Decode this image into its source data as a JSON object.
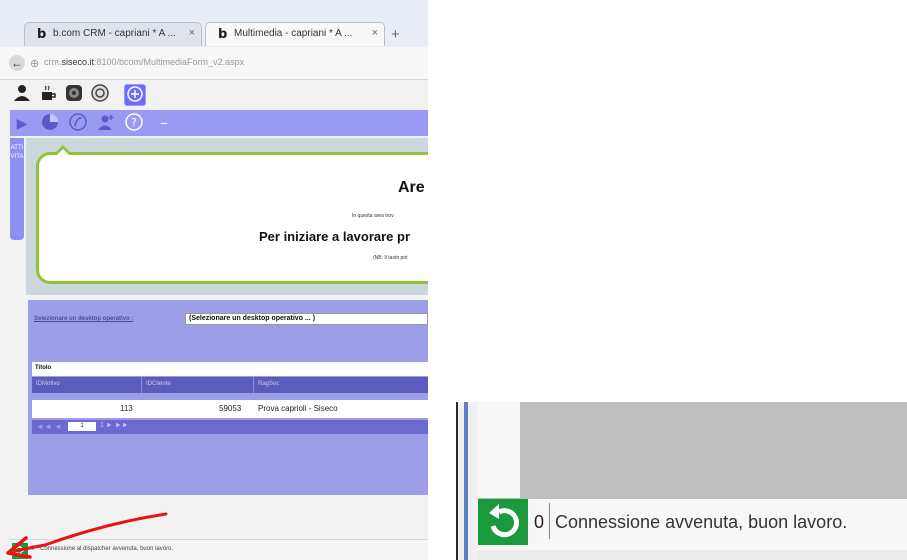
{
  "browser": {
    "tabs": [
      {
        "label": "b.com CRM - capriani * A ...",
        "favicon": "b",
        "close": "×"
      },
      {
        "label": "Multimedia - capriani * A ...",
        "favicon": "b",
        "close": "×"
      }
    ],
    "new_tab": "+",
    "url_prefix": "crm.",
    "url_domain": "siseco.it",
    "url_rest": ":8100/bcom/MultimediaForm_v2.aspx"
  },
  "toolbar": {
    "icons": [
      "user-icon",
      "coffee-icon",
      "phone-icon",
      "settings-circle-icon",
      "add-circle-icon"
    ],
    "sub_icons": [
      "play-icon",
      "pie-chart-icon",
      "leaf-icon",
      "user-add-icon",
      "help-icon",
      "minus-icon"
    ]
  },
  "sidebar": {
    "vertical_tab": "ATTIVITA"
  },
  "welcome": {
    "title": "Are",
    "subtitle": "In questa area trov",
    "headline": "Per iniziare a lavorare pr",
    "note": "(NB: Il tasto pot"
  },
  "desktop": {
    "label": "Selezionare un desktop operativo :",
    "selected": "(Selezionare un desktop operativo ... )"
  },
  "grid": {
    "title": "Titolo",
    "columns": [
      "IDMotivo",
      "IDCliente",
      "RagSoc"
    ],
    "rows": [
      {
        "id_motivo": "113",
        "id_cliente": "59053",
        "rag_soc": "Prova caprioli - Siseco"
      }
    ],
    "pager": {
      "arrows": "◄◄ ◄",
      "page": "1",
      "next": "1 ► ►►"
    }
  },
  "status_small": {
    "count": "0",
    "message": "Connessione al dispatcher avvenuta, buon lavoro."
  },
  "status_zoom": {
    "count": "0",
    "message": "Connessione avvenuta, buon lavoro."
  },
  "colors": {
    "status_green": "#1a9a3c",
    "toolbar_purple": "#9a99f4",
    "welcome_border": "#8fc43a",
    "arrow_red": "#e8140f"
  }
}
